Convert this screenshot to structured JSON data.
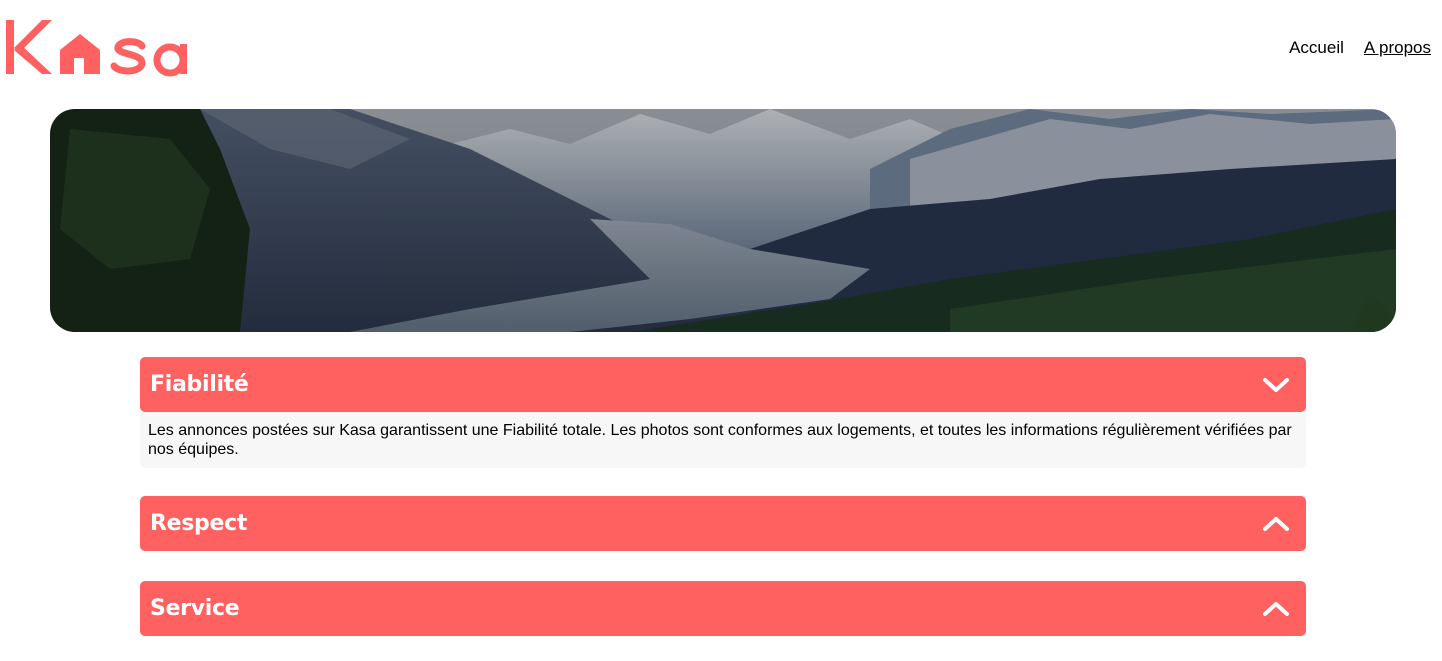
{
  "brand": {
    "logo_text": "Kasa",
    "accent_color": "#FF6060"
  },
  "nav": {
    "items": [
      {
        "label": "Accueil",
        "active": false
      },
      {
        "label": "A propos",
        "active": true
      }
    ]
  },
  "banner": {
    "image": "mountain-valley-landscape"
  },
  "collapses": [
    {
      "title": "Fiabilité",
      "expanded": true,
      "icon": "chevron-down-icon",
      "body": "Les annonces postées sur Kasa garantissent une Fiabilité totale. Les photos sont conformes aux logements, et toutes les informations régulièrement vérifiées par nos équipes."
    },
    {
      "title": "Respect",
      "expanded": false,
      "icon": "chevron-up-icon"
    },
    {
      "title": "Service",
      "expanded": false,
      "icon": "chevron-up-icon"
    }
  ]
}
